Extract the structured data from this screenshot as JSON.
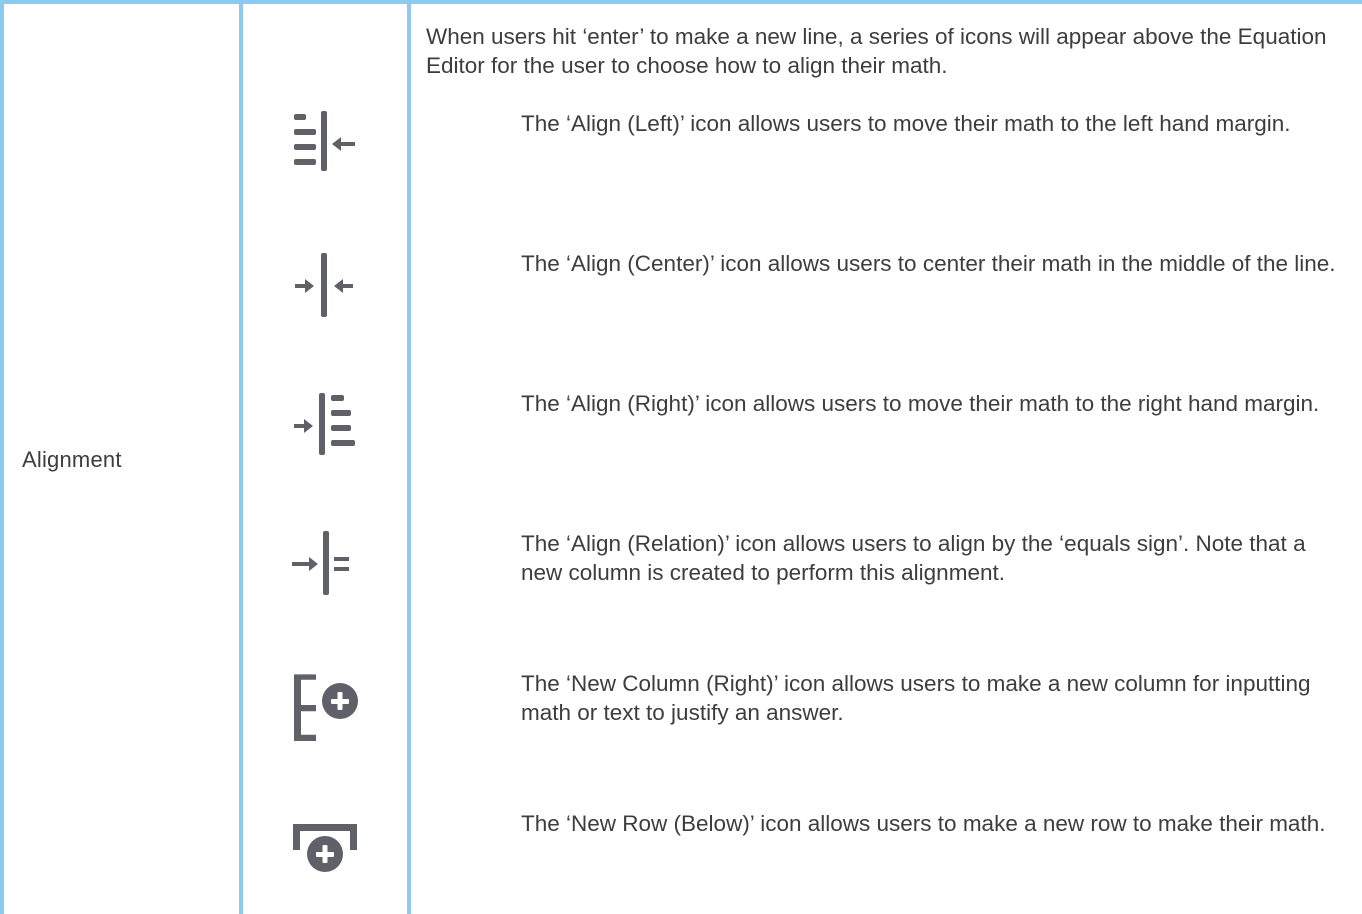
{
  "section_label": "Alignment",
  "intro": "When users hit ‘enter’ to make a new line, a series of icons will appear above the Equation Editor for the user to choose how to align their math.",
  "icon_color": "#5f6068",
  "border_color": "#8dcaf0",
  "items": [
    {
      "icon": "align-left-icon",
      "description": "The ‘Align (Left)’ icon allows users to move their math to the left hand margin."
    },
    {
      "icon": "align-center-icon",
      "description": "The ‘Align (Center)’ icon allows users to center their math in the middle of the line."
    },
    {
      "icon": "align-right-icon",
      "description": "The ‘Align (Right)’ icon allows users to move their math to the right hand margin."
    },
    {
      "icon": "align-relation-icon",
      "description": "The ‘Align (Relation)’ icon allows users to align by the ‘equals sign’. Note that a new column is created to perform this alignment."
    },
    {
      "icon": "new-column-right-icon",
      "description": "The ‘New Column (Right)’ icon allows users to make a new column for inputting math or text to justify an answer."
    },
    {
      "icon": "new-row-below-icon",
      "description": "The ‘New Row (Below)’ icon allows users to make a new row to make their math."
    }
  ]
}
